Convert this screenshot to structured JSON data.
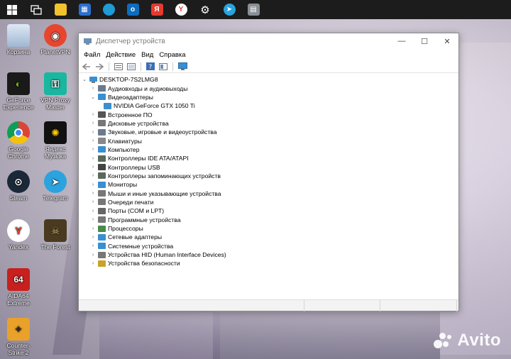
{
  "taskbar": {
    "icons": [
      "windows-start",
      "task-view",
      "file-explorer",
      "store",
      "edge",
      "outlook",
      "yandex-browser",
      "yandex-browser-alt",
      "settings",
      "telegram",
      "network-app"
    ]
  },
  "desktop": {
    "icons": [
      {
        "label": "Корзина",
        "icon": "recycle-bin"
      },
      {
        "label": "PlanetVPN",
        "icon": "planetvpn"
      },
      {
        "label": "GeForce Experience",
        "icon": "geforce"
      },
      {
        "label": "VPN Proxy Master",
        "icon": "vpn-proxy"
      },
      {
        "label": "Google Chrome",
        "icon": "chrome"
      },
      {
        "label": "Яндекс Музыка",
        "icon": "yandex-music"
      },
      {
        "label": "Steam",
        "icon": "steam"
      },
      {
        "label": "Telegram",
        "icon": "telegram"
      },
      {
        "label": "Yandex",
        "icon": "yandex"
      },
      {
        "label": "The Forest",
        "icon": "the-forest"
      },
      {
        "label": "AIDA64 Extreme",
        "icon": "aida64"
      },
      {
        "label": "Counter-Strike 2",
        "icon": "counter-strike"
      }
    ]
  },
  "window": {
    "title": "Диспетчер устройств",
    "menu": [
      "Файл",
      "Действие",
      "Вид",
      "Справка"
    ],
    "tree": {
      "root": "DESKTOP-7S2LMG8",
      "items": [
        {
          "label": "Аудиовходы и аудиовыходы",
          "expanded": false,
          "color": "#6b7b8c"
        },
        {
          "label": "Видеоадаптеры",
          "expanded": true,
          "color": "#3a8fd1"
        },
        {
          "label": "NVIDIA GeForce GTX 1050 Ti",
          "child": true,
          "color": "#3a8fd1"
        },
        {
          "label": "Встроенное ПО",
          "expanded": false,
          "color": "#555555"
        },
        {
          "label": "Дисковые устройства",
          "expanded": false,
          "color": "#777777"
        },
        {
          "label": "Звуковые, игровые и видеоустройства",
          "expanded": false,
          "color": "#6b7b8c"
        },
        {
          "label": "Клавиатуры",
          "expanded": false,
          "color": "#888888"
        },
        {
          "label": "Компьютер",
          "expanded": false,
          "color": "#3a8fd1"
        },
        {
          "label": "Контроллеры IDE ATA/ATAPI",
          "expanded": false,
          "color": "#5a6a5a"
        },
        {
          "label": "Контроллеры USB",
          "expanded": false,
          "color": "#444444"
        },
        {
          "label": "Контроллеры запоминающих устройств",
          "expanded": false,
          "color": "#5a6a5a"
        },
        {
          "label": "Мониторы",
          "expanded": false,
          "color": "#3a8fd1"
        },
        {
          "label": "Мыши и иные указывающие устройства",
          "expanded": false,
          "color": "#777777"
        },
        {
          "label": "Очереди печати",
          "expanded": false,
          "color": "#777777"
        },
        {
          "label": "Порты (COM и LPT)",
          "expanded": false,
          "color": "#666666"
        },
        {
          "label": "Программные устройства",
          "expanded": false,
          "color": "#777777"
        },
        {
          "label": "Процессоры",
          "expanded": false,
          "color": "#4a8a4a"
        },
        {
          "label": "Сетевые адаптеры",
          "expanded": false,
          "color": "#3a8fd1"
        },
        {
          "label": "Системные устройства",
          "expanded": false,
          "color": "#3a8fd1"
        },
        {
          "label": "Устройства HID (Human Interface Devices)",
          "expanded": false,
          "color": "#777777"
        },
        {
          "label": "Устройства безопасности",
          "expanded": false,
          "color": "#c9a227"
        }
      ]
    }
  },
  "watermark": {
    "text": "Avito"
  }
}
